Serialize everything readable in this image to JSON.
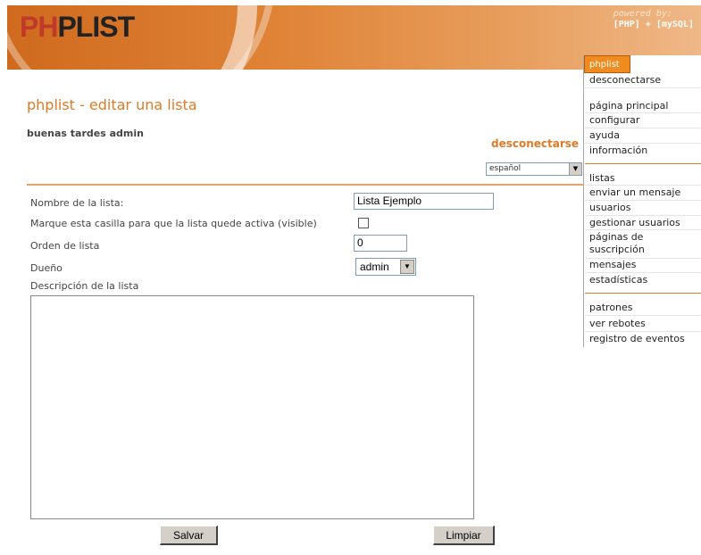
{
  "header": {
    "logo_prefix": "PH",
    "logo_text": "PLIST",
    "powered_by": "powered by:",
    "powered_tech": "[PHP] + [mySQL]"
  },
  "page": {
    "title": "phplist - editar una lista",
    "greeting": "buenas tardes admin",
    "logout_link": "desconectarse",
    "language": "español"
  },
  "form": {
    "name_label": "Nombre de la lista:",
    "name_value": "Lista Ejemplo",
    "active_label": "Marque esta casilla para que la lista quede activa (visible)",
    "active_checked": false,
    "order_label": "Orden de lista",
    "order_value": "0",
    "owner_label": "Dueño",
    "owner_value": "admin",
    "description_label": "Descripción de la lista",
    "description_value": "",
    "save_button": "Salvar",
    "reset_button": "Limpiar"
  },
  "menu": {
    "tab": "phplist",
    "group1": [
      "desconectarse"
    ],
    "group2": [
      "página principal",
      "configurar",
      "ayuda",
      "información"
    ],
    "group3": [
      "listas",
      "enviar un mensaje",
      "usuarios",
      "gestionar usuarios",
      "páginas de suscripción",
      "mensajes",
      "estadísticas"
    ],
    "group4": [
      "patrones",
      "ver rebotes",
      "registro de eventos"
    ]
  },
  "colors": {
    "accent": "#e07a26",
    "header_start": "#cf6a1e",
    "header_end": "#efb888"
  }
}
